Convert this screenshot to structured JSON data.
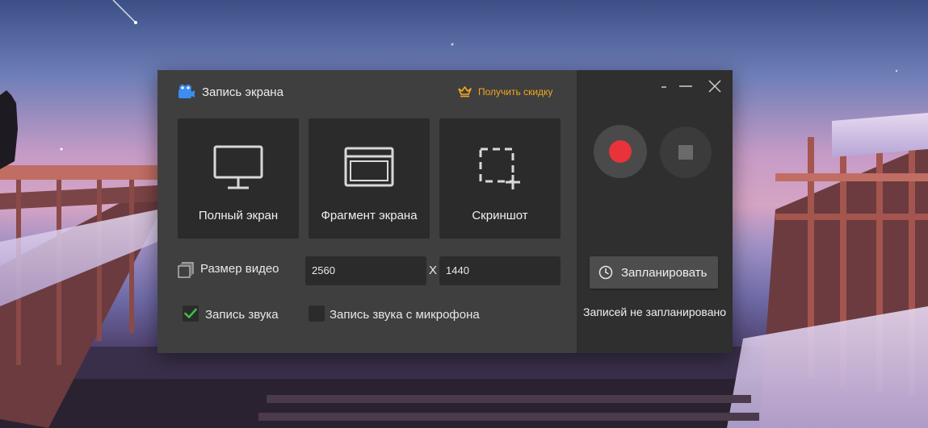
{
  "app": {
    "title": "Запись экрана",
    "promo_label": "Получить скидку",
    "accent_color": "#f0a820",
    "record_color": "#e8333a"
  },
  "tiles": [
    {
      "label": "Полный экран",
      "icon": "monitor-icon"
    },
    {
      "label": "Фрагмент экрана",
      "icon": "window-fragment-icon"
    },
    {
      "label": "Скриншот",
      "icon": "screenshot-crop-icon"
    }
  ],
  "video_size": {
    "label": "Размер видео",
    "width": "2560",
    "separator": "X",
    "height": "1440"
  },
  "audio": {
    "system_sound_label": "Запись звука",
    "system_sound_checked": true,
    "mic_label": "Запись звука с микрофона",
    "mic_checked": false
  },
  "window_controls": {
    "minimize_icon": "minimize-icon",
    "maximize_icon": "dash-icon",
    "close_icon": "close-icon"
  },
  "recorder": {
    "record_icon": "record-icon",
    "stop_icon": "stop-icon",
    "schedule_label": "Запланировать",
    "schedule_status": "Записей не запланировано"
  }
}
